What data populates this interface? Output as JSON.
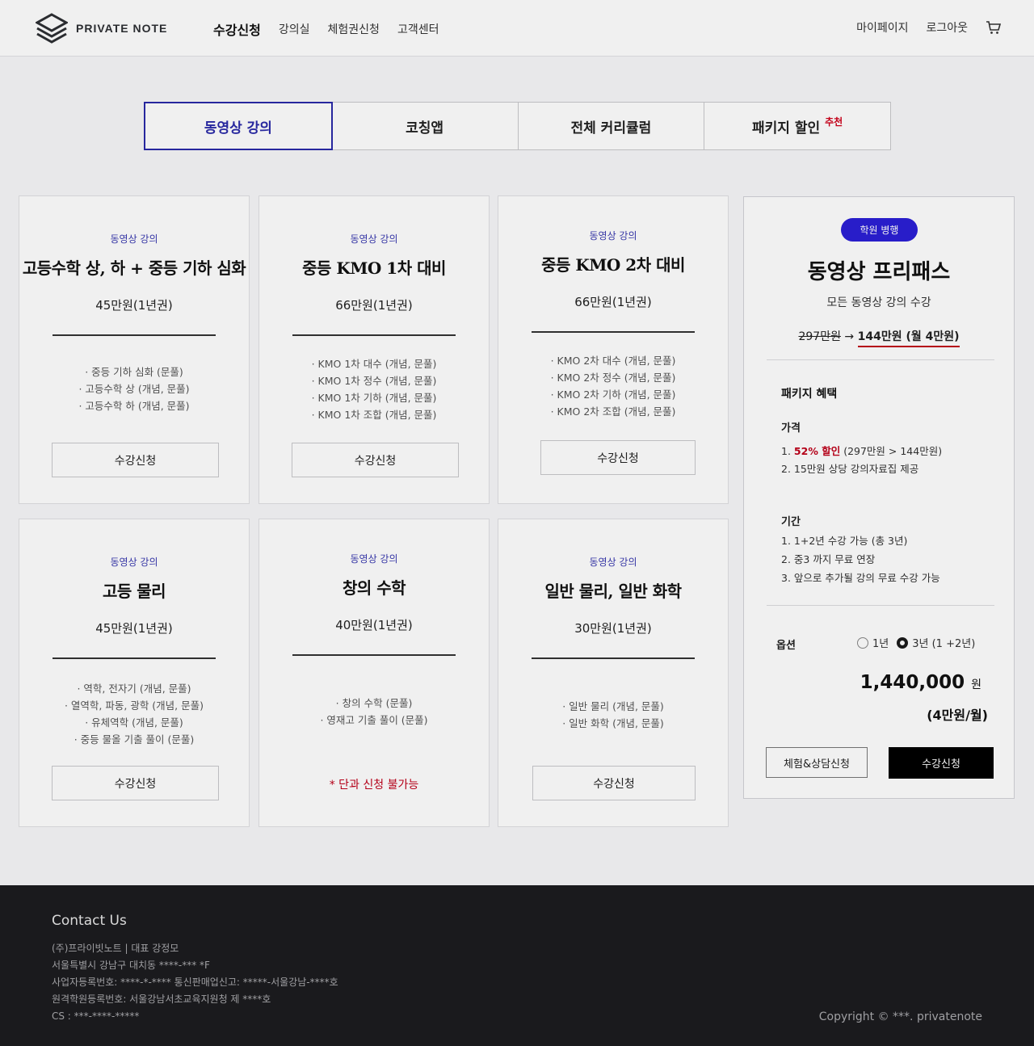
{
  "header": {
    "logo_text": "PRIVATE NOTE",
    "nav": [
      "수강신청",
      "강의실",
      "체험권신청",
      "고객센터"
    ],
    "right": [
      "마이페이지",
      "로그아웃"
    ],
    "cart_icon": "cart-icon"
  },
  "tabs": [
    {
      "label": "동영상 강의"
    },
    {
      "label": "코칭앱"
    },
    {
      "label": "전체 커리큘럼"
    },
    {
      "label": "패키지 할인",
      "badge": "추천"
    }
  ],
  "courses": [
    {
      "category": "동영상 강의",
      "title": "고등수학 상, 하 + 중등 기하 심화",
      "price": "45만원(1년권)",
      "items": [
        "· 중등 기하 심화 (문풀)",
        "· 고등수학 상 (개념, 문풀)",
        "· 고등수학 하 (개념, 문풀)"
      ],
      "button": "수강신청"
    },
    {
      "category": "동영상 강의",
      "title": "중등 KMO 1차 대비",
      "price": "66만원(1년권)",
      "items": [
        "· KMO 1차 대수 (개념, 문풀)",
        "· KMO 1차 정수 (개념, 문풀)",
        "· KMO 1차 기하 (개념, 문풀)",
        "· KMO 1차 조합 (개념, 문풀)"
      ],
      "button": "수강신청"
    },
    {
      "category": "동영상 강의",
      "title": "중등 KMO 2차 대비",
      "price": "66만원(1년권)",
      "items": [
        "· KMO 2차 대수 (개념, 문풀)",
        "· KMO 2차 정수 (개념, 문풀)",
        "· KMO 2차 기하 (개념, 문풀)",
        "· KMO 2차 조합 (개념, 문풀)"
      ],
      "button": "수강신청"
    },
    {
      "category": "동영상 강의",
      "title": "고등 물리",
      "price": "45만원(1년권)",
      "items": [
        "· 역학, 전자기 (개념, 문풀)",
        "· 열역학, 파동, 광학 (개념, 문풀)",
        "· 유체역학 (개념, 문풀)",
        "· 중등 물올 기출 풀이 (문풀)"
      ],
      "button": "수강신청"
    },
    {
      "category": "동영상 강의",
      "title": "창의 수학",
      "price": "40만원(1년권)",
      "items": [
        "· 창의 수학 (문풀)",
        "· 영재고 기출 풀이 (문풀)"
      ],
      "notice": "* 단과 신청 불가능"
    },
    {
      "category": "동영상 강의",
      "title": "일반 물리, 일반 화학",
      "price": "30만원(1년권)",
      "items": [
        "· 일반 물리 (개념, 문풀)",
        "· 일반 화학 (개념, 문풀)"
      ],
      "button": "수강신청"
    }
  ],
  "package": {
    "badge": "학원 병행",
    "title": "동영상 프리패스",
    "subtitle": "모든 동영상 강의 수강",
    "old_price": "297만원",
    "arrow": "→",
    "new_price": "144만원 (월 4만원)",
    "benefits_title": "패키지 혜택",
    "price_label": "가격",
    "price_item1_num": "1.",
    "price_item1_red": "52% 할인",
    "price_item1_rest": "(297만원 > 144만원)",
    "price_item2": "2. 15만원 상당 강의자료집 제공",
    "period_label": "기간",
    "period_items": [
      "1. 1+2년 수강 가능 (총 3년)",
      "2. 중3 까지 무료 연장",
      "3. 앞으로 추가될 강의 무료 수강 가능"
    ],
    "option_label": "옵션",
    "options": [
      {
        "label": "1년",
        "selected": false
      },
      {
        "label": "3년 (1 +2년)",
        "selected": true
      }
    ],
    "total": "1,440,000",
    "won": "원",
    "monthly": "(4만원/월)",
    "btn_trial": "체험&상담신청",
    "btn_apply": "수강신청",
    "accent": "#2b1fd6"
  },
  "footer": {
    "title": "Contact Us",
    "lines": [
      "(주)프라이빗노트 | 대표 강정모",
      "서울특별시 강남구 대치동 ****-*** *F",
      "사업자등록번호: ****-*-**** 통신판매업신고: *****-서울강남-****호",
      "원격학원등록번호: 서울강남서초교육지원청 제 ****호",
      "CS : ***-****-*****"
    ],
    "copyright": "Copyright © ***. privatenote"
  }
}
